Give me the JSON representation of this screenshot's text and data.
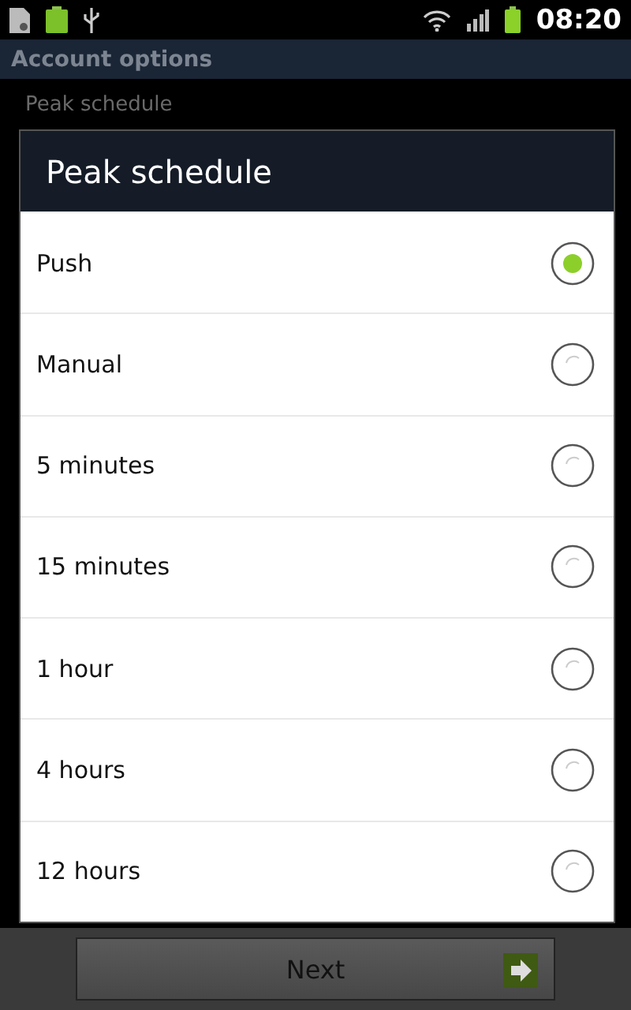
{
  "status_bar": {
    "time": "08:20"
  },
  "header": {
    "title": "Account options"
  },
  "setting": {
    "label": "Peak schedule"
  },
  "dialog": {
    "title": "Peak schedule",
    "options": [
      {
        "label": "Push",
        "selected": true
      },
      {
        "label": "Manual",
        "selected": false
      },
      {
        "label": "5 minutes",
        "selected": false
      },
      {
        "label": "15 minutes",
        "selected": false
      },
      {
        "label": "1 hour",
        "selected": false
      },
      {
        "label": "4 hours",
        "selected": false
      },
      {
        "label": "12 hours",
        "selected": false
      }
    ]
  },
  "footer": {
    "button": "Next"
  }
}
